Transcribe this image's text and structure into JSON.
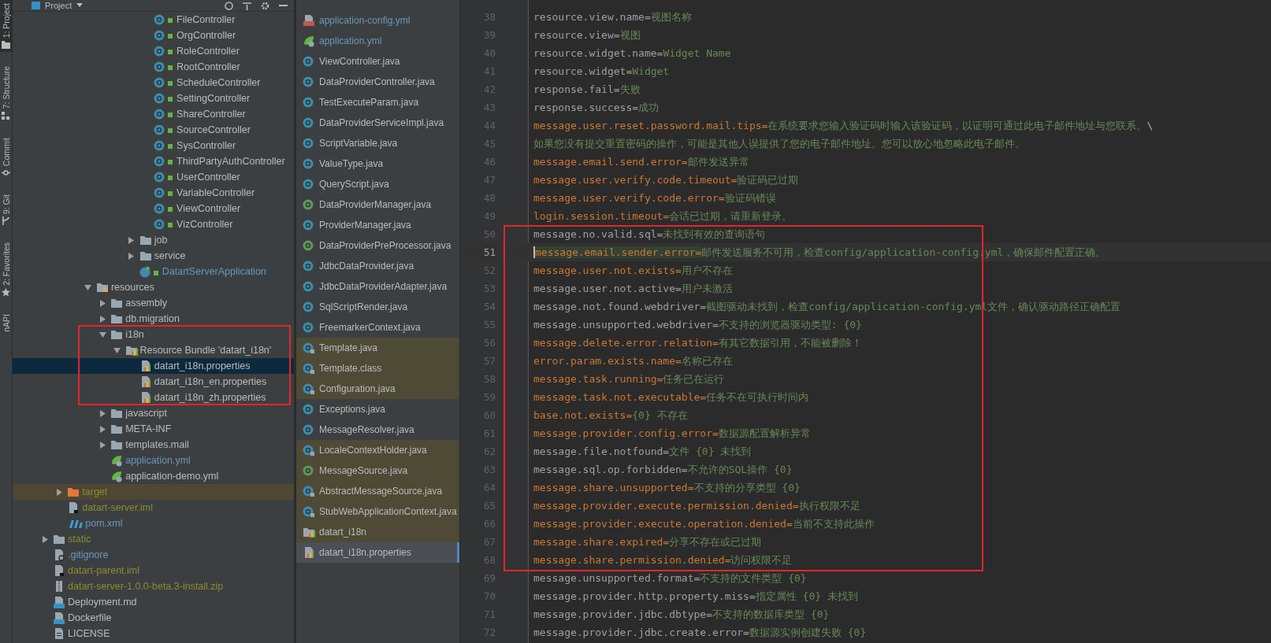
{
  "tool_strip": [
    {
      "label": "1: Project",
      "kind": "folder",
      "selected": true
    },
    {
      "label": "7: Structure",
      "kind": "structure",
      "selected": false
    },
    {
      "label": "Commit",
      "kind": "commit",
      "selected": false
    },
    {
      "label": "9: Git",
      "kind": "git",
      "selected": false
    },
    {
      "label": "2: Favorites",
      "kind": "star",
      "selected": false
    },
    {
      "label": "nAPI",
      "kind": "plain",
      "selected": false
    }
  ],
  "project_panel": {
    "title": "Project",
    "tree": [
      {
        "children": [
          {
            "children": [
              {
                "children": [
                  {
                    "children": [
                      {
                        "children": [
                          {
                            "children": [
                              {
                                "children": [
                                  {
                                    "label": "FileController",
                                    "kind": "controller",
                                    "changed": false,
                                    "ignored": false,
                                    "selected": false
                                  },
                                  {
                                    "label": "OrgController",
                                    "kind": "controller",
                                    "changed": false,
                                    "ignored": false,
                                    "selected": false
                                  },
                                  {
                                    "label": "RoleController",
                                    "kind": "controller",
                                    "changed": false,
                                    "ignored": false,
                                    "selected": false
                                  },
                                  {
                                    "label": "RootController",
                                    "kind": "controller",
                                    "changed": false,
                                    "ignored": false,
                                    "selected": false
                                  },
                                  {
                                    "label": "ScheduleController",
                                    "kind": "controller",
                                    "changed": false,
                                    "ignored": false,
                                    "selected": false
                                  },
                                  {
                                    "label": "SettingController",
                                    "kind": "controller",
                                    "changed": false,
                                    "ignored": false,
                                    "selected": false
                                  },
                                  {
                                    "label": "ShareController",
                                    "kind": "controller",
                                    "changed": false,
                                    "ignored": false,
                                    "selected": false
                                  },
                                  {
                                    "label": "SourceController",
                                    "kind": "controller",
                                    "changed": false,
                                    "ignored": false,
                                    "selected": false
                                  },
                                  {
                                    "label": "SysController",
                                    "kind": "controller",
                                    "changed": false,
                                    "ignored": false,
                                    "selected": false
                                  },
                                  {
                                    "label": "ThirdPartyAuthController",
                                    "kind": "controller",
                                    "changed": false,
                                    "ignored": false,
                                    "selected": false
                                  },
                                  {
                                    "label": "UserController",
                                    "kind": "controller",
                                    "changed": false,
                                    "ignored": false,
                                    "selected": false
                                  },
                                  {
                                    "label": "VariableController",
                                    "kind": "controller",
                                    "changed": false,
                                    "ignored": false,
                                    "selected": false
                                  },
                                  {
                                    "label": "ViewController",
                                    "kind": "controller",
                                    "changed": false,
                                    "ignored": false,
                                    "selected": false
                                  },
                                  {
                                    "label": "VizController",
                                    "kind": "controller",
                                    "changed": false,
                                    "ignored": false,
                                    "selected": false
                                  }
                                ]
                              },
                              {
                                "label": "job",
                                "kind": "folder",
                                "changed": false,
                                "ignored": false,
                                "selected": false,
                                "expanded": false
                              },
                              {
                                "label": "service",
                                "kind": "folder",
                                "changed": false,
                                "ignored": false,
                                "selected": false,
                                "expanded": false
                              },
                              {
                                "label": "DatartServerApplication",
                                "kind": "app",
                                "changed": true,
                                "ignored": false,
                                "selected": false
                              }
                            ]
                          }
                        ]
                      }
                    ]
                  },
                  {
                    "label": "resources",
                    "kind": "resources",
                    "changed": false,
                    "ignored": false,
                    "selected": false,
                    "expanded": true,
                    "children": [
                      {
                        "label": "assembly",
                        "kind": "folder",
                        "changed": false,
                        "ignored": false,
                        "selected": false,
                        "expanded": false
                      },
                      {
                        "label": "db.migration",
                        "kind": "folder",
                        "changed": false,
                        "ignored": false,
                        "selected": false,
                        "expanded": false
                      },
                      {
                        "label": "i18n",
                        "kind": "folder",
                        "changed": false,
                        "ignored": false,
                        "selected": false,
                        "expanded": true,
                        "framed": true,
                        "children": [
                          {
                            "label": "Resource Bundle 'datart_i18n'",
                            "kind": "bundle",
                            "changed": false,
                            "ignored": false,
                            "selected": false,
                            "expanded": true,
                            "children": [
                              {
                                "label": "datart_i18n.properties",
                                "kind": "properties",
                                "changed": false,
                                "ignored": false,
                                "selected": true
                              },
                              {
                                "label": "datart_i18n_en.properties",
                                "kind": "properties",
                                "changed": false,
                                "ignored": false,
                                "selected": false
                              },
                              {
                                "label": "datart_i18n_zh.properties",
                                "kind": "properties",
                                "changed": false,
                                "ignored": false,
                                "selected": false
                              }
                            ]
                          }
                        ]
                      },
                      {
                        "label": "javascript",
                        "kind": "folder",
                        "changed": false,
                        "ignored": false,
                        "selected": false,
                        "expanded": false
                      },
                      {
                        "label": "META-INF",
                        "kind": "folder",
                        "changed": false,
                        "ignored": false,
                        "selected": false,
                        "expanded": false
                      },
                      {
                        "label": "templates.mail",
                        "kind": "folder",
                        "changed": false,
                        "ignored": false,
                        "selected": false,
                        "expanded": false
                      },
                      {
                        "label": "application.yml",
                        "kind": "spring",
                        "changed": true,
                        "ignored": false,
                        "selected": false
                      },
                      {
                        "label": "application-demo.yml",
                        "kind": "spring",
                        "changed": false,
                        "ignored": false,
                        "selected": false
                      }
                    ]
                  }
                ]
              }
            ]
          },
          {
            "label": "target",
            "kind": "excluded",
            "changed": false,
            "ignored": true,
            "selected": false,
            "expanded": false,
            "shaded": true
          },
          {
            "label": "datart-server.iml",
            "kind": "iml",
            "changed": false,
            "ignored": true,
            "selected": false
          },
          {
            "label": "pom.xml",
            "kind": "maven",
            "changed": true,
            "ignored": false,
            "selected": false
          }
        ]
      },
      {
        "label": "static",
        "kind": "folder",
        "changed": false,
        "ignored": true,
        "selected": false,
        "expanded": false
      },
      {
        "label": ".gitignore",
        "kind": "gitignore",
        "changed": true,
        "ignored": false,
        "selected": false
      },
      {
        "label": "datart-parent.iml",
        "kind": "iml",
        "changed": false,
        "ignored": true,
        "selected": false
      },
      {
        "label": "datart-server-1.0.0-beta.3-install.zip",
        "kind": "zip",
        "changed": false,
        "ignored": true,
        "selected": false
      },
      {
        "label": "Deployment.md",
        "kind": "md",
        "changed": false,
        "ignored": false,
        "selected": false
      },
      {
        "label": "Dockerfile",
        "kind": "docker",
        "changed": false,
        "ignored": false,
        "selected": false
      },
      {
        "label": "LICENSE",
        "kind": "text",
        "changed": false,
        "ignored": false,
        "selected": false
      }
    ]
  },
  "file_list": [
    {
      "label": "application-config.yml",
      "kind": "yml",
      "changed": true,
      "external": false,
      "selected": false
    },
    {
      "label": "application.yml",
      "kind": "spring",
      "changed": true,
      "external": false,
      "selected": false
    },
    {
      "label": "ViewController.java",
      "kind": "class",
      "changed": false,
      "external": false,
      "selected": false
    },
    {
      "label": "DataProviderController.java",
      "kind": "class",
      "changed": false,
      "external": false,
      "selected": false
    },
    {
      "label": "TestExecuteParam.java",
      "kind": "class",
      "changed": false,
      "external": false,
      "selected": false
    },
    {
      "label": "DataProviderServiceImpl.java",
      "kind": "class",
      "changed": false,
      "external": false,
      "selected": false
    },
    {
      "label": "ScriptVariable.java",
      "kind": "class",
      "changed": false,
      "external": false,
      "selected": false
    },
    {
      "label": "ValueType.java",
      "kind": "enum",
      "changed": false,
      "external": false,
      "selected": false
    },
    {
      "label": "QueryScript.java",
      "kind": "class",
      "changed": false,
      "external": false,
      "selected": false
    },
    {
      "label": "DataProviderManager.java",
      "kind": "interface",
      "changed": false,
      "external": false,
      "selected": false
    },
    {
      "label": "ProviderManager.java",
      "kind": "class",
      "changed": false,
      "external": false,
      "selected": false
    },
    {
      "label": "DataProviderPreProcessor.java",
      "kind": "interface",
      "changed": false,
      "external": false,
      "selected": false
    },
    {
      "label": "JdbcDataProvider.java",
      "kind": "class",
      "changed": false,
      "external": false,
      "selected": false
    },
    {
      "label": "JdbcDataProviderAdapter.java",
      "kind": "class",
      "changed": false,
      "external": false,
      "selected": false
    },
    {
      "label": "SqlScriptRender.java",
      "kind": "class",
      "changed": false,
      "external": false,
      "selected": false
    },
    {
      "label": "FreemarkerContext.java",
      "kind": "class",
      "changed": false,
      "external": false,
      "selected": false
    },
    {
      "label": "Template.java",
      "kind": "library",
      "changed": false,
      "external": true,
      "selected": false
    },
    {
      "label": "Template.class",
      "kind": "library",
      "changed": false,
      "external": true,
      "selected": false
    },
    {
      "label": "Configuration.java",
      "kind": "library",
      "changed": false,
      "external": true,
      "selected": false
    },
    {
      "label": "Exceptions.java",
      "kind": "class",
      "changed": false,
      "external": false,
      "selected": false
    },
    {
      "label": "MessageResolver.java",
      "kind": "class",
      "changed": false,
      "external": false,
      "selected": false
    },
    {
      "label": "LocaleContextHolder.java",
      "kind": "library",
      "changed": false,
      "external": true,
      "selected": false
    },
    {
      "label": "MessageSource.java",
      "kind": "interface",
      "changed": false,
      "external": true,
      "selected": false
    },
    {
      "label": "AbstractMessageSource.java",
      "kind": "library",
      "changed": false,
      "external": true,
      "selected": false
    },
    {
      "label": "StubWebApplicationContext.java",
      "kind": "library",
      "changed": false,
      "external": true,
      "selected": false
    },
    {
      "label": "datart_i18n",
      "kind": "bundle",
      "changed": false,
      "external": true,
      "selected": false
    },
    {
      "label": "datart_i18n.properties",
      "kind": "properties",
      "changed": false,
      "external": true,
      "selected": true
    }
  ],
  "editor": {
    "lines_above": [
      {
        "number": "38",
        "key": "resource.view.name=",
        "value": "视图名称",
        "used": false,
        "current": false
      },
      {
        "number": "39",
        "key": "resource.view=",
        "value": "视图",
        "used": false,
        "current": false
      },
      {
        "number": "40",
        "key": "resource.widget.name=",
        "value": "Widget Name",
        "used": false,
        "current": false
      },
      {
        "number": "41",
        "key": "resource.widget=",
        "value": "Widget",
        "used": false,
        "current": false
      },
      {
        "number": "42",
        "key": "response.fail=",
        "value": "失败",
        "used": false,
        "current": false
      },
      {
        "number": "43",
        "key": "response.success=",
        "value": "成功",
        "used": false,
        "current": false
      },
      {
        "number": "44",
        "key": "message.user.reset.password.mail.tips=",
        "value": "在系统要求您输入验证码时输入该验证码，以证明可通过此电子邮件地址与您联系。",
        "tail": "\\",
        "used": true,
        "current": false
      },
      {
        "number": "45",
        "value": "如果您没有提交重置密码的操作，可能是其他人误提供了您的电子邮件地址。您可以放心地忽略此电子邮件。",
        "current": false
      },
      {
        "number": "46",
        "key": "message.email.send.error=",
        "value": "邮件发送异常",
        "used": true,
        "current": false
      },
      {
        "number": "47",
        "key": "message.user.verify.code.timeout=",
        "value": "验证码已过期",
        "used": true,
        "current": false
      },
      {
        "number": "48",
        "key": "message.user.verify.code.error=",
        "value": "验证码错误",
        "used": true,
        "current": false
      },
      {
        "number": "49",
        "key": "login.session.timeout=",
        "value": "会话已过期，请重新登录。",
        "used": true,
        "current": false
      }
    ],
    "framed_lines": [
      {
        "number": "50",
        "key": "message.no.valid.sql=",
        "value": "未找到有效的查询语句",
        "used": false,
        "current": false
      },
      {
        "number": "51",
        "key": "message.email.sender.error=",
        "value": "邮件发送服务不可用，检查config/application-config.yml，确保邮件配置正确。",
        "used": true,
        "current": true
      },
      {
        "number": "52",
        "key": "message.user.not.exists=",
        "value": "用户不存在",
        "used": true,
        "current": false
      },
      {
        "number": "53",
        "key": "message.user.not.active=",
        "value": "用户未激活",
        "used": false,
        "current": false
      },
      {
        "number": "54",
        "key": "message.not.found.webdriver=",
        "value": "截图驱动未找到，检查config/application-config.yml文件，确认驱动路径正确配置",
        "used": false,
        "current": false
      },
      {
        "number": "55",
        "key": "message.unsupported.webdriver=",
        "value": "不支持的浏览器驱动类型: {0}",
        "used": false,
        "current": false
      },
      {
        "number": "56",
        "key": "message.delete.error.relation=",
        "value": "有其它数据引用，不能被删除！",
        "used": true,
        "current": false
      },
      {
        "number": "57",
        "key": "error.param.exists.name=",
        "value": "名称已存在",
        "used": true,
        "current": false
      },
      {
        "number": "58",
        "key": "message.task.running=",
        "value": "任务已在运行",
        "used": true,
        "current": false
      },
      {
        "number": "59",
        "key": "message.task.not.executable=",
        "value": "任务不在可执行时间内",
        "used": true,
        "current": false
      },
      {
        "number": "60",
        "key": "base.not.exists=",
        "value": "{0} 不存在",
        "used": true,
        "current": false
      },
      {
        "number": "61",
        "key": "message.provider.config.error=",
        "value": "数据源配置解析异常",
        "used": true,
        "current": false
      },
      {
        "number": "62",
        "key": "message.file.notfound=",
        "value": "文件 {0} 未找到",
        "used": false,
        "current": false
      },
      {
        "number": "63",
        "key": "message.sql.op.forbidden=",
        "value": "不允许的SQL操作 {0}",
        "used": false,
        "current": false
      },
      {
        "number": "64",
        "key": "message.share.unsupported=",
        "value": "不支持的分享类型 {0}",
        "used": true,
        "current": false
      },
      {
        "number": "65",
        "key": "message.provider.execute.permission.denied=",
        "value": "执行权限不足",
        "used": true,
        "current": false
      },
      {
        "number": "66",
        "key": "message.provider.execute.operation.denied=",
        "value": "当前不支持此操作",
        "used": true,
        "current": false
      },
      {
        "number": "67",
        "key": "message.share.expired=",
        "value": "分享不存在或已过期",
        "used": true,
        "current": false
      },
      {
        "number": "68",
        "key": "message.share.permission.denied=",
        "value": "访问权限不足",
        "used": true,
        "current": false
      }
    ],
    "lines_below": [
      {
        "number": "69",
        "key": "message.unsupported.format=",
        "value": "不支持的文件类型 {0}",
        "used": false,
        "current": false
      },
      {
        "number": "70",
        "key": "message.provider.http.property.miss=",
        "value": "指定属性 {0} 未找到",
        "used": false,
        "current": false
      },
      {
        "number": "71",
        "key": "message.provider.jdbc.dbtype=",
        "value": "不支持的数据库类型 {0}",
        "used": false,
        "current": false
      },
      {
        "number": "72",
        "key": "message.provider.jdbc.create.error=",
        "value": "数据源实例创建失败 {0}",
        "used": false,
        "current": false
      }
    ]
  }
}
